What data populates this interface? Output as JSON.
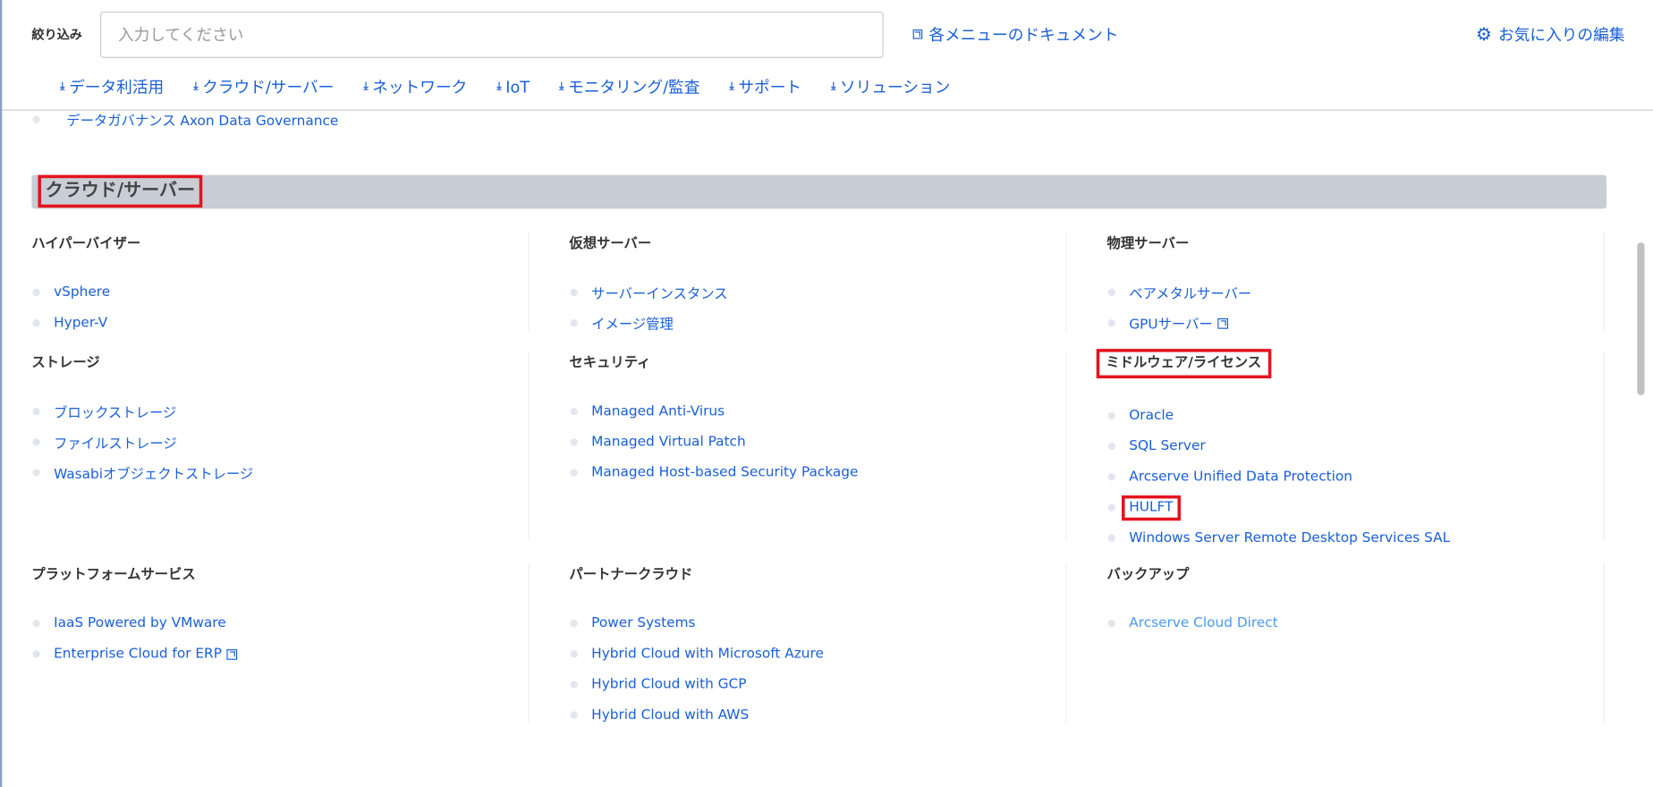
{
  "header": {
    "filter_label": "絞り込み",
    "search_placeholder": "入力してください",
    "docs_link": "各メニューのドキュメント",
    "favorites_link": "お気に入りの編集",
    "nav": [
      "データ利活用",
      "クラウド/サーバー",
      "ネットワーク",
      "IoT",
      "モニタリング/監査",
      "サポート",
      "ソリューション"
    ]
  },
  "clipped_item": "データガバナンス Axon Data Governance",
  "section": {
    "title": "クラウド/サーバー",
    "groups": [
      {
        "title": "ハイパーバイザー",
        "items": [
          "vSphere",
          "Hyper-V"
        ]
      },
      {
        "title": "仮想サーバー",
        "items": [
          "サーバーインスタンス",
          "イメージ管理"
        ]
      },
      {
        "title": "物理サーバー",
        "items": [
          "ベアメタルサーバー",
          "GPUサーバー"
        ]
      },
      {
        "title": "ストレージ",
        "items": [
          "ブロックストレージ",
          "ファイルストレージ",
          "Wasabiオブジェクトストレージ"
        ]
      },
      {
        "title": "セキュリティ",
        "items": [
          "Managed Anti-Virus",
          "Managed Virtual Patch",
          "Managed Host-based Security Package"
        ]
      },
      {
        "title": "ミドルウェア/ライセンス",
        "items": [
          "Oracle",
          "SQL Server",
          "Arcserve Unified Data Protection",
          "HULFT",
          "Windows Server Remote Desktop Services SAL"
        ]
      },
      {
        "title": "プラットフォームサービス",
        "items": [
          "IaaS Powered by VMware",
          "Enterprise Cloud for ERP"
        ]
      },
      {
        "title": "パートナークラウド",
        "items": [
          "Power Systems",
          "Hybrid Cloud with Microsoft Azure",
          "Hybrid Cloud with GCP",
          "Hybrid Cloud with AWS"
        ]
      },
      {
        "title": "バックアップ",
        "items": [
          "Arcserve Cloud Direct"
        ]
      }
    ]
  },
  "colors": {
    "link": "#1a5fd8",
    "highlight": "#e3141e",
    "section_bar": "#c9ced6"
  }
}
